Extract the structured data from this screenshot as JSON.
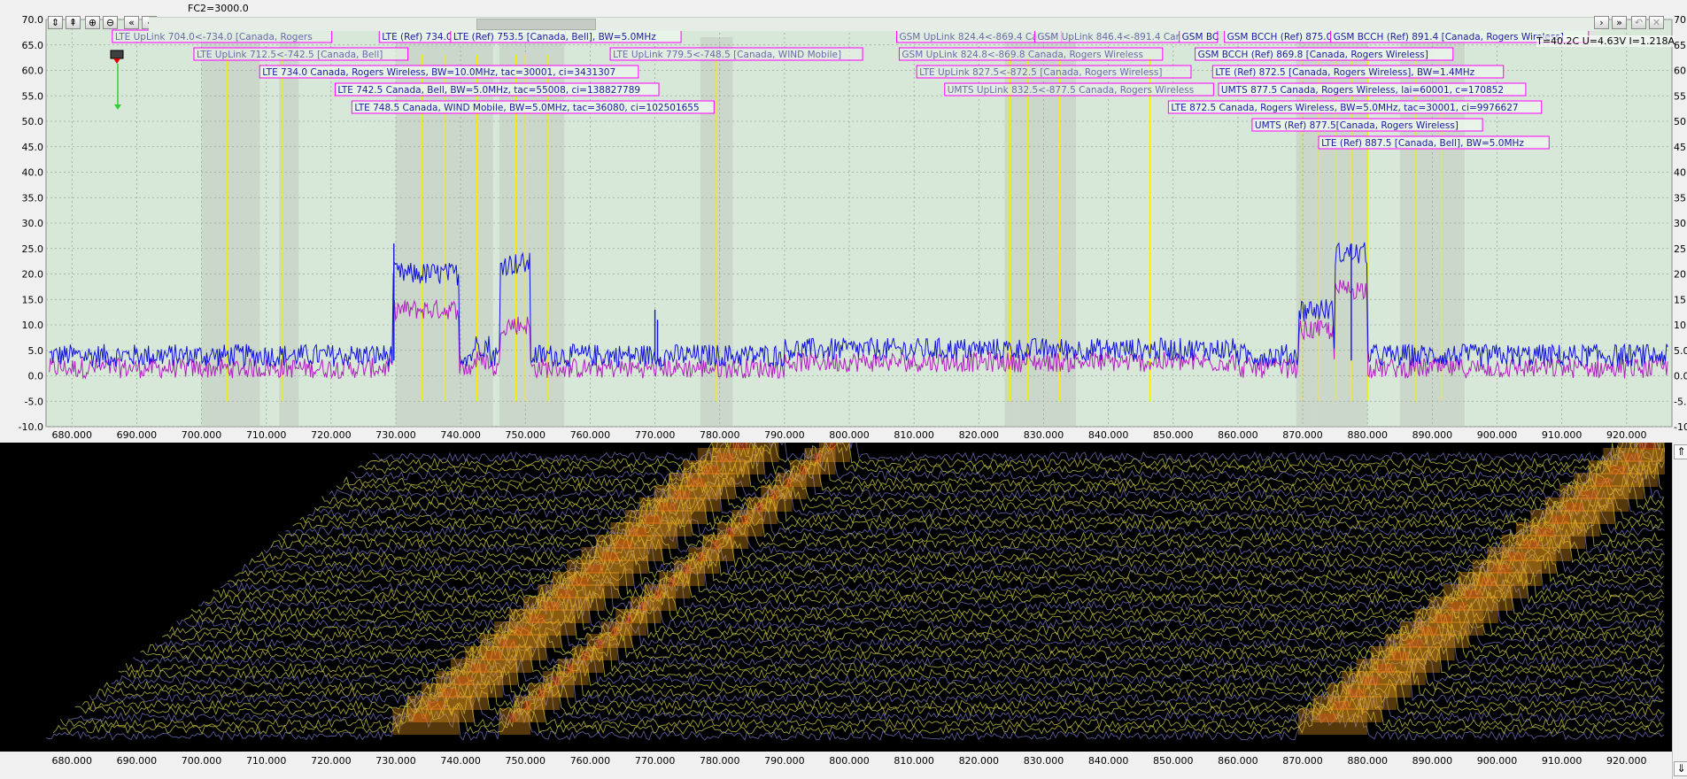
{
  "header": {
    "fc2_label": "FC2=3000.0",
    "status": "T=40.2C U=4.63V I=1.218A"
  },
  "toolbar": {
    "buttons": [
      {
        "name": "fit-vertical-button",
        "glyph": "⇕"
      },
      {
        "name": "marker-add-button",
        "glyph": "⇞"
      },
      {
        "name": "zoom-in-button",
        "glyph": "⊕"
      },
      {
        "name": "zoom-out-button",
        "glyph": "⊖"
      },
      {
        "name": "scroll-far-left-button",
        "glyph": "«"
      },
      {
        "name": "scroll-left-button",
        "glyph": "‹"
      }
    ],
    "right_buttons": [
      {
        "name": "scroll-right-button",
        "glyph": "›"
      },
      {
        "name": "scroll-far-right-button",
        "glyph": "»"
      },
      {
        "name": "undo-zoom-button",
        "glyph": "↶"
      },
      {
        "name": "close-panel-button",
        "glyph": "✕"
      }
    ]
  },
  "spectrum": {
    "x_min": 676,
    "x_max": 927,
    "y_min": -10,
    "y_max": 70,
    "y_ticks": [
      "70.0",
      "65.0",
      "60.0",
      "55.0",
      "50.0",
      "45.0",
      "40.0",
      "35.0",
      "30.0",
      "25.0",
      "20.0",
      "15.0",
      "10.0",
      "5.0",
      "0.0",
      "-5.0",
      "-10.0"
    ],
    "x_ticks": [
      "680.000",
      "690.000",
      "700.000",
      "710.000",
      "720.000",
      "730.000",
      "740.000",
      "750.000",
      "760.000",
      "770.000",
      "780.000",
      "790.000",
      "800.000",
      "810.000",
      "820.000",
      "830.000",
      "840.000",
      "850.000",
      "860.000",
      "870.000",
      "880.000",
      "890.000",
      "900.000",
      "910.000",
      "920.000"
    ],
    "colors": {
      "background": "#d8e8d8",
      "trace_max": "#1010e0",
      "trace_avg": "#b020c0",
      "marker_line": "#f0f000",
      "label_border": "#ff00ff",
      "label_text": "#1a1aa0",
      "band_shade": "#c0c8c0"
    },
    "bands": [
      {
        "from": 700,
        "to": 709
      },
      {
        "from": 712,
        "to": 715
      },
      {
        "from": 730,
        "to": 735
      },
      {
        "from": 735,
        "to": 740
      },
      {
        "from": 740,
        "to": 745
      },
      {
        "from": 746,
        "to": 751
      },
      {
        "from": 751,
        "to": 756
      },
      {
        "from": 777,
        "to": 782
      },
      {
        "from": 824,
        "to": 826
      },
      {
        "from": 826,
        "to": 830
      },
      {
        "from": 830,
        "to": 835
      },
      {
        "from": 869,
        "to": 872
      },
      {
        "from": 872,
        "to": 875
      },
      {
        "from": 875,
        "to": 880
      },
      {
        "from": 885,
        "to": 890
      },
      {
        "from": 890,
        "to": 895
      }
    ],
    "marker_lines": [
      704,
      712.5,
      734,
      737.5,
      742.5,
      748.5,
      750,
      753.5,
      779.5,
      824.4,
      824.8,
      827.5,
      832.5,
      846.4,
      869.8,
      872.5,
      875,
      877.5,
      880,
      887.5,
      891.4
    ],
    "markers": [
      {
        "text": "LTE UpLink 704.0<-734.0 [Canada, Rogers",
        "freq": 704,
        "row": 0,
        "dim": true
      },
      {
        "text": "LTE (Ref) 734.0 [Canada, Rogers W",
        "freq": 734,
        "row": 0,
        "dim": false
      },
      {
        "text": "LTE (Ref) 753.5 [Canada, Bell], BW=5.0MHz",
        "freq": 753.5,
        "row": 0,
        "dim": false
      },
      {
        "text": "LTE UpLink 712.5<-742.5 [Canada, Bell]",
        "freq": 712.5,
        "row": 1,
        "dim": true
      },
      {
        "text": "LTE UpLink 779.5<-748.5 [Canada, WIND Mobile]",
        "freq": 779.5,
        "row": 1,
        "dim": true
      },
      {
        "text": "LTE 734.0 Canada, Rogers Wireless, BW=10.0MHz, tac=30001, ci=3431307",
        "freq": 734,
        "row": 2,
        "dim": false
      },
      {
        "text": "LTE 742.5 Canada, Bell, BW=5.0MHz, tac=55008, ci=138827789",
        "freq": 742.5,
        "row": 3,
        "dim": false
      },
      {
        "text": "LTE 748.5 Canada, WIND Mobile, BW=5.0MHz, tac=36080, ci=102501655",
        "freq": 748.5,
        "row": 4,
        "dim": false
      },
      {
        "text": "GSM UpLink 824.4<-869.4 Canad",
        "freq": 824.4,
        "row": 0,
        "dim": true
      },
      {
        "text": "GSM UpLink 846.4<-891.4 Canada",
        "freq": 846.4,
        "row": 0,
        "dim": true
      },
      {
        "text": "GSM BC",
        "freq": 869.4,
        "row": 0,
        "dim": false
      },
      {
        "text": "GSM BCCH (Ref) 875.0 [",
        "freq": 875,
        "row": 0,
        "dim": false
      },
      {
        "text": "GSM BCCH (Ref) 891.4 [Canada, Rogers Wireless]",
        "freq": 891.4,
        "row": 0,
        "dim": false
      },
      {
        "text": "GSM UpLink 824.8<-869.8 Canada, Rogers Wireless",
        "freq": 824.8,
        "row": 1,
        "dim": true
      },
      {
        "text": "GSM BCCH (Ref) 869.8 [Canada, Rogers Wireless]",
        "freq": 869.8,
        "row": 1,
        "dim": false
      },
      {
        "text": "LTE UpLink 827.5<-872.5 [Canada, Rogers Wireless]",
        "freq": 827.5,
        "row": 2,
        "dim": true
      },
      {
        "text": "LTE (Ref) 872.5 [Canada, Rogers Wireless], BW=1.4MHz",
        "freq": 872.5,
        "row": 2,
        "dim": false
      },
      {
        "text": "UMTS UpLink 832.5<-877.5 Canada, Rogers Wireless",
        "freq": 832.5,
        "row": 3,
        "dim": true
      },
      {
        "text": "UMTS 877.5 Canada, Rogers Wireless, lai=60001, c=170852",
        "freq": 877.5,
        "row": 3,
        "dim": false
      },
      {
        "text": "LTE 872.5 Canada, Rogers Wireless, BW=5.0MHz, tac=30001, ci=9976627",
        "freq": 872.5,
        "row": 4,
        "dim": false
      },
      {
        "text": "UMTS (Ref) 877.5[Canada, Rogers Wireless]",
        "freq": 877.5,
        "row": 5,
        "dim": false
      },
      {
        "text": "LTE (Ref) 887.5 [Canada, Bell], BW=5.0MHz",
        "freq": 887.5,
        "row": 6,
        "dim": false
      }
    ],
    "signals": [
      {
        "from": 729.5,
        "to": 739.8,
        "level_max": 20,
        "level_avg": 13
      },
      {
        "from": 746,
        "to": 750.8,
        "level_max": 22,
        "level_avg": 10
      },
      {
        "from": 742,
        "to": 744.5,
        "level_max": 6,
        "level_avg": 3
      },
      {
        "from": 869.3,
        "to": 874.8,
        "level_max": 13,
        "level_avg": 9
      },
      {
        "from": 875,
        "to": 880,
        "level_max": 24,
        "level_avg": 17
      }
    ],
    "spikes": [
      {
        "freq": 729.7,
        "value": 26
      },
      {
        "freq": 770,
        "value": 13
      },
      {
        "freq": 770.4,
        "value": 11
      },
      {
        "freq": 877.5,
        "value": 26
      }
    ]
  },
  "waterfall": {
    "x_ticks": [
      "680.000",
      "690.000",
      "700.000",
      "710.000",
      "720.000",
      "730.000",
      "740.000",
      "750.000",
      "760.000",
      "770.000",
      "780.000",
      "790.000",
      "800.000",
      "810.000",
      "820.000",
      "830.000",
      "840.000",
      "850.000",
      "860.000",
      "870.000",
      "880.000",
      "890.000",
      "900.000",
      "910.000",
      "920.000"
    ],
    "colors": {
      "background": "#000000",
      "noise": "#b8b840",
      "noise_alt": "#6a6ab0",
      "hot": "#f0a020",
      "peak": "#e02010"
    },
    "hot_bands": [
      {
        "from": 729.5,
        "to": 739.8
      },
      {
        "from": 746,
        "to": 750.8
      },
      {
        "from": 869.3,
        "to": 880
      }
    ]
  },
  "scroll": {
    "up_glyph": "⇑",
    "down_glyph": "⇓"
  }
}
